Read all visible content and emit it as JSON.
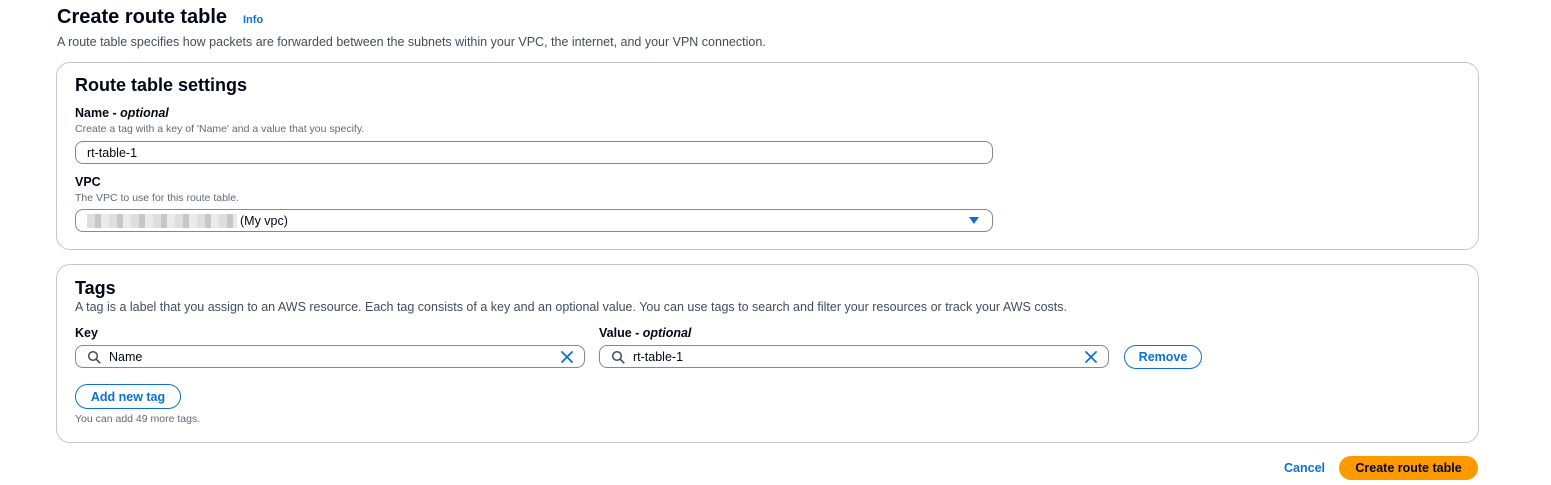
{
  "header": {
    "title": "Create route table",
    "info_link": "Info",
    "description": "A route table specifies how packets are forwarded between the subnets within your VPC, the internet, and your VPN connection."
  },
  "settings": {
    "title": "Route table settings",
    "name_label": "Name - ",
    "name_optional": "optional",
    "name_description": "Create a tag with a key of 'Name' and a value that you specify.",
    "name_value": "rt-table-1",
    "vpc_label": "VPC",
    "vpc_description": "The VPC to use for this route table.",
    "vpc_value_suffix": "(My vpc)",
    "vpc_caret_icon": "caret-down-icon"
  },
  "tags": {
    "title": "Tags",
    "description": "A tag is a label that you assign to an AWS resource. Each tag consists of a key and an optional value. You can use tags to search and filter your resources or track your AWS costs.",
    "key_label": "Key",
    "value_label": "Value - ",
    "value_optional": "optional",
    "rows": [
      {
        "key": "Name",
        "value": "rt-table-1"
      }
    ],
    "remove_label": "Remove",
    "add_label": "Add new tag",
    "remaining_text": "You can add 49 more tags."
  },
  "footer": {
    "cancel_label": "Cancel",
    "create_label": "Create route table"
  },
  "colors": {
    "accent": "#0972d3",
    "primary_button": "#ff9900",
    "text": "#000716"
  }
}
